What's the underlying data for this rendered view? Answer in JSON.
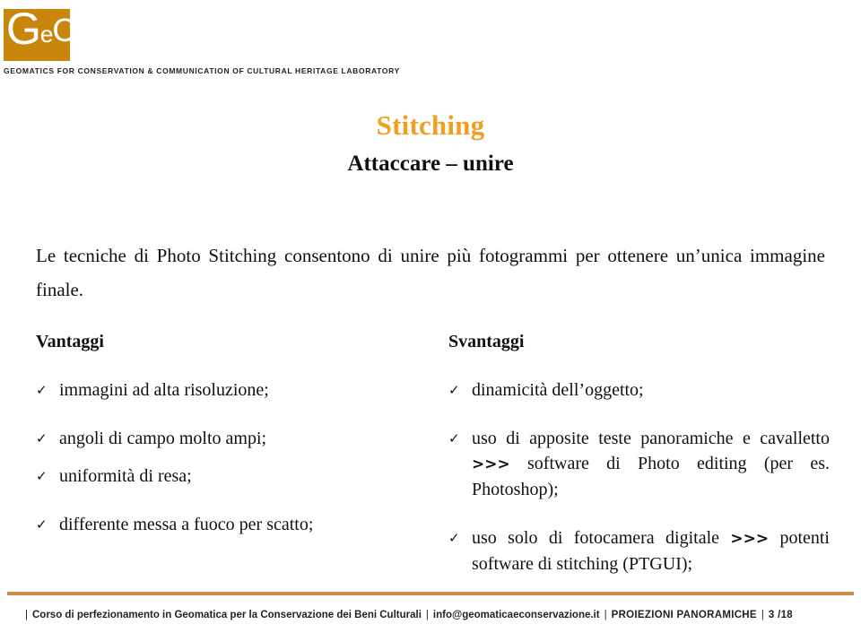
{
  "header": {
    "logo_text_g": "G",
    "logo_text_e": "e",
    "logo_text_c": "C",
    "logo_text_o": "O",
    "logo_full": "GeCO",
    "tagline": "GEOMATICS FOR CONSERVATION & COMMUNICATION OF CULTURAL HERITAGE LABORATORY",
    "brand_orange": "#C8870C"
  },
  "slide": {
    "title": "Stitching",
    "subtitle": "Attaccare – unire",
    "title_color": "#F0A020",
    "intro": "Le tecniche di Photo Stitching consentono di unire più fotogrammi per ottenere un’unica immagine finale.",
    "check_glyph": "✓"
  },
  "columns": {
    "left": {
      "heading": "Vantaggi",
      "items": [
        "immagini ad alta risoluzione;",
        "angoli di campo molto ampi;",
        "uniformità di resa;",
        "differente messa a fuoco per scatto;"
      ]
    },
    "right": {
      "heading": "Svantaggi",
      "items": [
        "dinamicità dell’oggetto;",
        "uso di apposite teste panoramiche e cavalletto >>> software di Photo editing (per es. Photoshop);",
        "uso solo di fotocamera digitale >>> potenti software di stitching (PTGUI);"
      ]
    }
  },
  "footer": {
    "course": "Corso di perfezionamento in Geomatica per la Conservazione dei Beni Culturali",
    "email": "info@geomaticaeconservazione.it",
    "section": "PROIEZIONI PANORAMICHE",
    "page": "3 /18",
    "separator": "|",
    "rule_color": "#CB8C4E"
  }
}
